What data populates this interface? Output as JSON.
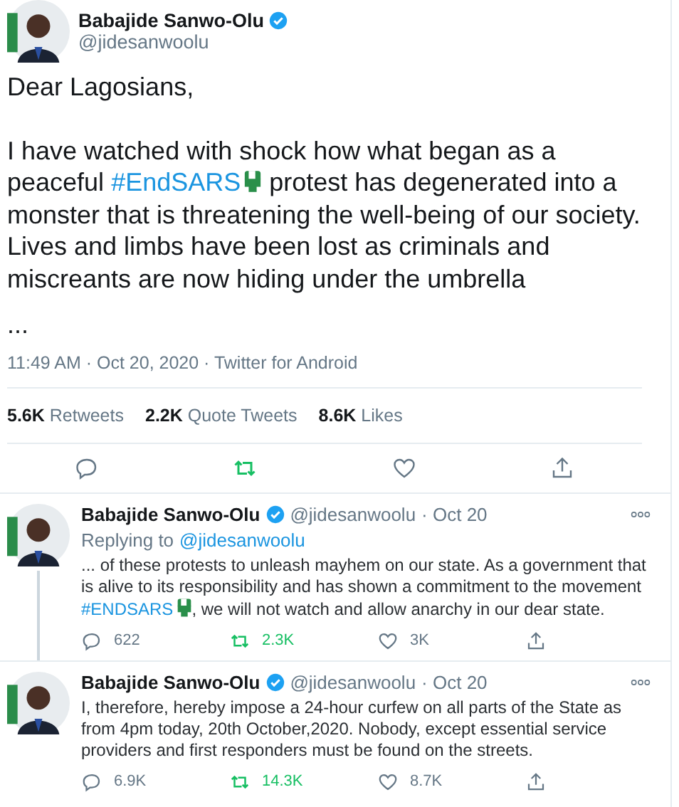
{
  "main_tweet": {
    "name": "Babajide Sanwo-Olu",
    "handle": "@jidesanwoolu",
    "verified": true,
    "paragraphs": [
      [
        {
          "kind": "text",
          "text": "Dear Lagosians,"
        }
      ],
      [
        {
          "kind": "text",
          "text": "I have watched with shock how what began as a peaceful "
        },
        {
          "kind": "hashtag",
          "text": "#EndSARS",
          "fist_icon": true
        },
        {
          "kind": "text",
          "text": " protest has degenerated into a monster that is threatening the well-being of our society. Lives and limbs have been lost as criminals and miscreants are now hiding under the umbrella"
        }
      ],
      [
        {
          "kind": "text",
          "text": "..."
        }
      ]
    ],
    "meta": "11:49 AM · Oct 20, 2020 · Twitter for Android",
    "stats": [
      {
        "count": "5.6K",
        "label": "Retweets"
      },
      {
        "count": "2.2K",
        "label": "Quote Tweets"
      },
      {
        "count": "8.6K",
        "label": "Likes"
      }
    ],
    "retweeted": true
  },
  "replies": [
    {
      "name": "Babajide Sanwo-Olu",
      "verified": true,
      "handle": "@jidesanwoolu",
      "date": "· Oct 20",
      "replying_label": "Replying to",
      "replying_to": "@jidesanwoolu",
      "thread_line": true,
      "text": [
        {
          "kind": "text",
          "text": "... of these protests to unleash mayhem on our state. As a government that is alive to its responsibility and has shown a commitment to the movement "
        },
        {
          "kind": "hashtag",
          "text": "#ENDSARS",
          "fist_icon": true
        },
        {
          "kind": "text",
          "text": ", we will not watch and allow anarchy in our dear state."
        }
      ],
      "replies": "622",
      "retweets": "2.3K",
      "likes": "3K",
      "retweeted": true
    },
    {
      "name": "Babajide Sanwo-Olu",
      "verified": true,
      "handle": "@jidesanwoolu",
      "date": "· Oct 20",
      "thread_line": false,
      "text": [
        {
          "kind": "text",
          "text": "I, therefore, hereby impose a 24-hour curfew on all parts of the State as from 4pm today, 20th October,2020. Nobody, except essential service providers and first responders must be found on the streets."
        }
      ],
      "replies": "6.9K",
      "retweets": "14.3K",
      "likes": "8.7K",
      "retweeted": true
    }
  ]
}
